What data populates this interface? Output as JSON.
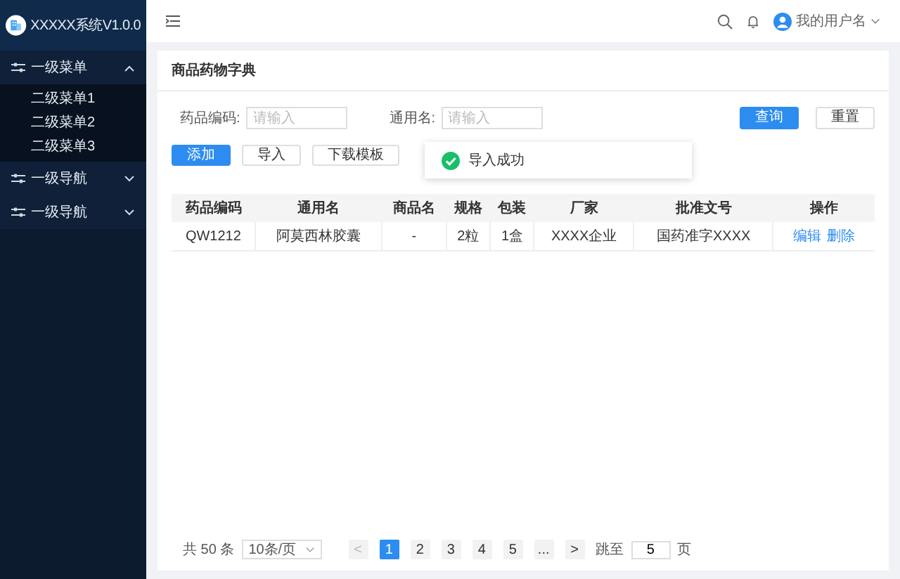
{
  "sidebar": {
    "logo_text": "XXXXX系统V1.0.0",
    "menus": [
      {
        "label": "一级菜单",
        "expanded": true,
        "children": [
          {
            "label": "二级菜单1"
          },
          {
            "label": "二级菜单2"
          },
          {
            "label": "二级菜单3"
          }
        ]
      },
      {
        "label": "一级导航",
        "expanded": false
      },
      {
        "label": "一级导航",
        "expanded": false
      }
    ]
  },
  "header": {
    "user_name": "我的用户名"
  },
  "page_title": "商品药物字典",
  "filters": [
    {
      "label": "药品编码:",
      "placeholder": "请输入"
    },
    {
      "label": "通用名:",
      "placeholder": "请输入"
    }
  ],
  "filter_buttons": [
    {
      "label": "查询",
      "kind": "primary"
    },
    {
      "label": "重置",
      "kind": "default"
    }
  ],
  "actions": [
    {
      "label": "添加",
      "kind": "primary"
    },
    {
      "label": "导入",
      "kind": "default"
    },
    {
      "label": "下载模板",
      "kind": "default"
    }
  ],
  "toast": {
    "text": "导入成功"
  },
  "table": {
    "columns": [
      "药品编码",
      "通用名",
      "商品名",
      "规格",
      "包装",
      "厂家",
      "批准文号",
      "操作"
    ],
    "rows": [
      {
        "cells": [
          "QW1212",
          "阿莫西林胶囊",
          "-",
          "2粒",
          "1盒",
          "XXXX企业",
          "国药准字XXXX"
        ],
        "actions": [
          "编辑",
          "删除"
        ]
      }
    ]
  },
  "pagination": {
    "total": "共 50 条",
    "page_size": "10条/页",
    "prev": {
      "label": "<",
      "disabled": true
    },
    "pages": [
      {
        "label": "1",
        "selected": true
      },
      {
        "label": "2",
        "selected": false
      },
      {
        "label": "3",
        "selected": false
      },
      {
        "label": "4",
        "selected": false
      },
      {
        "label": "5",
        "selected": false
      },
      {
        "label": "...",
        "selected": false
      }
    ],
    "next": {
      "label": ">",
      "disabled": false
    },
    "jump_label": "跳至",
    "jump_value": "5",
    "jump_suffix": "页"
  }
}
